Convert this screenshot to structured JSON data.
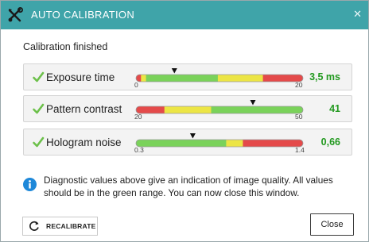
{
  "window": {
    "title": "AUTO CALIBRATION",
    "title_icon": "tools-icon",
    "close_icon": "close-icon",
    "close_glyph": "✕"
  },
  "status_text": "Calibration finished",
  "metrics": [
    {
      "label": "Exposure time",
      "value": "3,5 ms",
      "min_label": "0",
      "max_label": "20",
      "marker": 0.23,
      "zones": [
        {
          "from": 0,
          "to": 0.03,
          "color": "red"
        },
        {
          "from": 0.03,
          "to": 0.06,
          "color": "yellow"
        },
        {
          "from": 0.06,
          "to": 0.49,
          "color": "green"
        },
        {
          "from": 0.49,
          "to": 0.76,
          "color": "yellow"
        },
        {
          "from": 0.76,
          "to": 1.0,
          "color": "red"
        }
      ]
    },
    {
      "label": "Pattern contrast",
      "value": "41",
      "min_label": "20",
      "max_label": "50",
      "marker": 0.7,
      "zones": [
        {
          "from": 0,
          "to": 0.17,
          "color": "red"
        },
        {
          "from": 0.17,
          "to": 0.45,
          "color": "yellow"
        },
        {
          "from": 0.45,
          "to": 1.0,
          "color": "green"
        }
      ]
    },
    {
      "label": "Hologram noise",
      "value": "0,66",
      "min_label": "0.3",
      "max_label": "1.4",
      "marker": 0.34,
      "zones": [
        {
          "from": 0,
          "to": 0.54,
          "color": "green"
        },
        {
          "from": 0.54,
          "to": 0.64,
          "color": "yellow"
        },
        {
          "from": 0.64,
          "to": 1.0,
          "color": "red"
        }
      ]
    }
  ],
  "colors": {
    "titlebar": "#3fa4a9",
    "red": "#e44a4a",
    "yellow": "#ece545",
    "green": "#7ad25a",
    "value_green": "#22991f",
    "info_blue": "#1e88d9"
  },
  "info_text": "Diagnostic values above give an indication of image quality. All values should be in the green range. You can now close this window.",
  "buttons": {
    "recalibrate_label": "RECALIBRATE",
    "recalibrate_icon": "refresh-icon",
    "close_label": "Close"
  }
}
